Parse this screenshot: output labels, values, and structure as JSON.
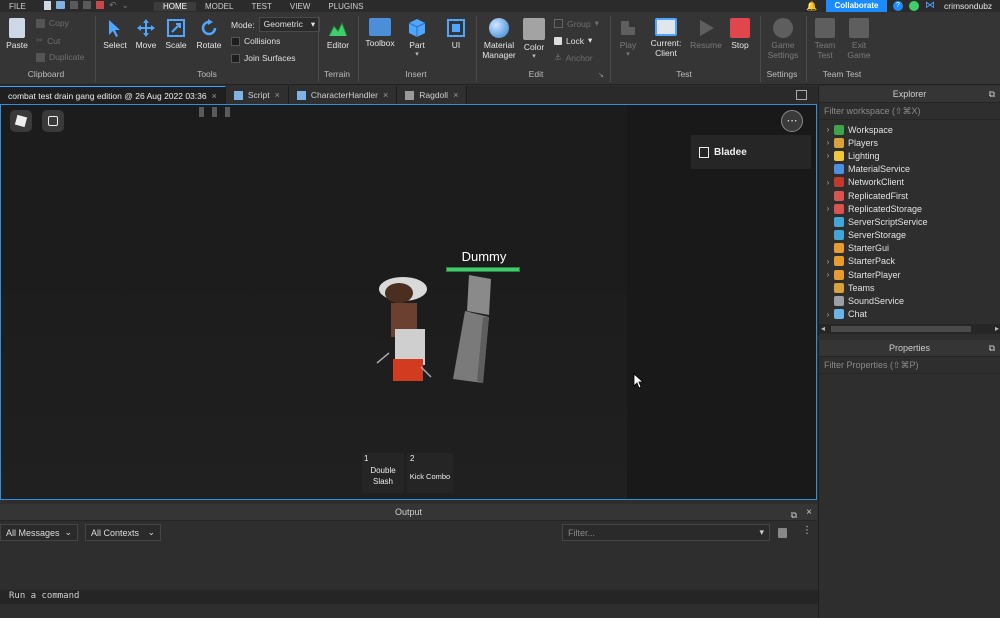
{
  "menu": {
    "file": "FILE",
    "tabs": [
      "HOME",
      "MODEL",
      "TEST",
      "VIEW",
      "PLUGINS"
    ],
    "collaborate": "Collaborate",
    "username": "crimsondubz"
  },
  "ribbon": {
    "clipboard": {
      "paste": "Paste",
      "copy": "Copy",
      "cut": "Cut",
      "duplicate": "Duplicate",
      "label": "Clipboard"
    },
    "tools": {
      "select": "Select",
      "move": "Move",
      "scale": "Scale",
      "rotate": "Rotate",
      "mode_label": "Mode:",
      "mode_value": "Geometric",
      "collisions": "Collisions",
      "join_surfaces": "Join Surfaces",
      "label": "Tools"
    },
    "terrain": {
      "editor": "Editor",
      "label": "Terrain"
    },
    "insert": {
      "toolbox": "Toolbox",
      "part": "Part",
      "ui": "UI",
      "label": "Insert"
    },
    "edit": {
      "material_manager_1": "Material",
      "material_manager_2": "Manager",
      "color": "Color",
      "group": "Group",
      "lock": "Lock",
      "anchor": "Anchor",
      "label": "Edit"
    },
    "test": {
      "play": "Play",
      "current_1": "Current:",
      "current_2": "Client",
      "resume": "Resume",
      "stop": "Stop",
      "label": "Test"
    },
    "settings": {
      "game_settings_1": "Game",
      "game_settings_2": "Settings",
      "label": "Settings"
    },
    "team_test": {
      "team_test_1": "Team",
      "team_test_2": "Test",
      "exit_game_1": "Exit",
      "exit_game_2": "Game",
      "label": "Team Test"
    }
  },
  "doc_tabs": [
    {
      "label": "combat test drain gang edition @ 26 Aug 2022 03:36"
    },
    {
      "label": "Script"
    },
    {
      "label": "CharacterHandler"
    },
    {
      "label": "Ragdoll"
    }
  ],
  "viewport": {
    "player_name": "Bladee",
    "npc_name": "Dummy",
    "npc_health": 1.0,
    "hotbar": [
      {
        "key": "1",
        "name_1": "Double",
        "name_2": "Slash"
      },
      {
        "key": "2",
        "name_1": "Kick Combo",
        "name_2": ""
      }
    ]
  },
  "output": {
    "title": "Output",
    "messages_filter": "All Messages",
    "contexts_filter": "All Contexts",
    "filter_placeholder": "Filter...",
    "command_placeholder": "Run a command"
  },
  "explorer": {
    "title": "Explorer",
    "filter_placeholder": "Filter workspace (⇧⌘X)",
    "items": [
      {
        "label": "Workspace",
        "expandable": true,
        "color": "#3fa34d"
      },
      {
        "label": "Players",
        "expandable": true,
        "color": "#d9a23b"
      },
      {
        "label": "Lighting",
        "expandable": true,
        "color": "#f0c93a"
      },
      {
        "label": "MaterialService",
        "expandable": false,
        "color": "#4f8fe0"
      },
      {
        "label": "NetworkClient",
        "expandable": true,
        "color": "#c0392b"
      },
      {
        "label": "ReplicatedFirst",
        "expandable": false,
        "color": "#d9534f"
      },
      {
        "label": "ReplicatedStorage",
        "expandable": true,
        "color": "#d9534f"
      },
      {
        "label": "ServerScriptService",
        "expandable": false,
        "color": "#41a6d8"
      },
      {
        "label": "ServerStorage",
        "expandable": false,
        "color": "#41a6d8"
      },
      {
        "label": "StarterGui",
        "expandable": false,
        "color": "#e89b2f"
      },
      {
        "label": "StarterPack",
        "expandable": true,
        "color": "#e89b2f"
      },
      {
        "label": "StarterPlayer",
        "expandable": true,
        "color": "#e89b2f"
      },
      {
        "label": "Teams",
        "expandable": false,
        "color": "#d9a23b"
      },
      {
        "label": "SoundService",
        "expandable": false,
        "color": "#9aa0a6"
      },
      {
        "label": "Chat",
        "expandable": true,
        "color": "#6cb4e8"
      }
    ]
  },
  "properties": {
    "title": "Properties",
    "filter_placeholder": "Filter Properties (⇧⌘P)"
  },
  "colors": {
    "accent": "#2f8fe0",
    "collaborate": "#1a8cff",
    "health": "#3ecf6a",
    "stop": "#e0474c"
  }
}
